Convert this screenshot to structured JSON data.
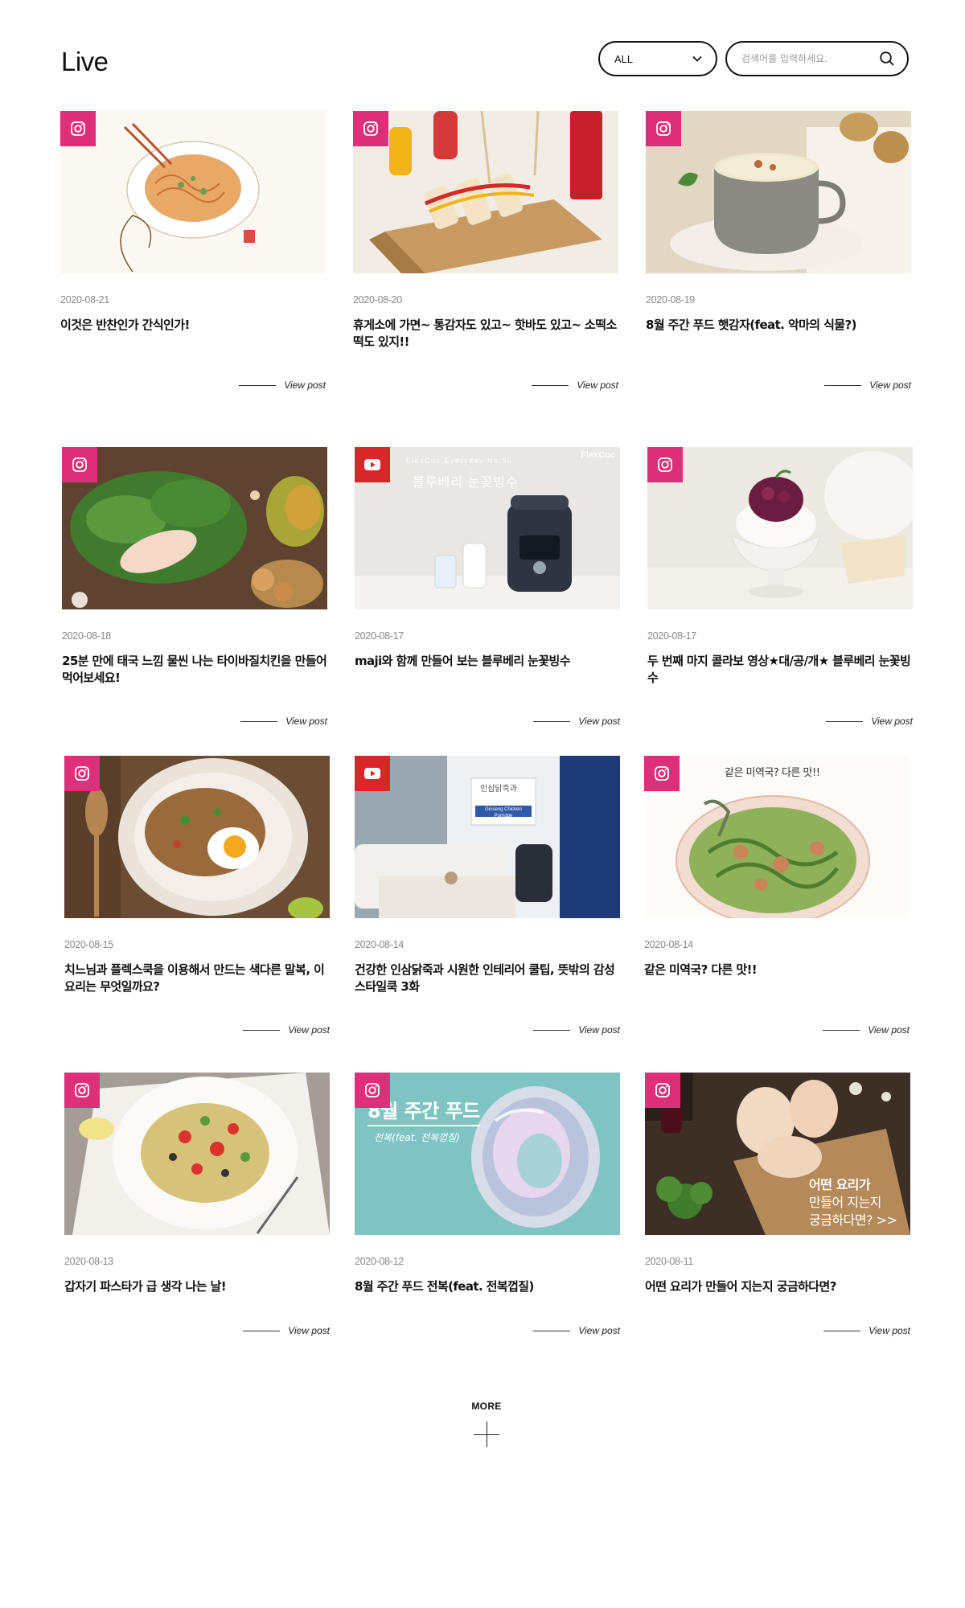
{
  "header": {
    "title": "Live",
    "filter": {
      "value": "ALL"
    },
    "search": {
      "placeholder": "검색어를 입력하세요."
    }
  },
  "posts": [
    {
      "type": "instagram",
      "date": "2020-08-21",
      "title": "이것은 반찬인가 간식인가!",
      "link": "View post"
    },
    {
      "type": "instagram",
      "date": "2020-08-20",
      "title": "휴게소에 가면~ 통감자도 있고~ 핫바도 있고~ 소떡소떡도 있지!!",
      "link": "View post"
    },
    {
      "type": "instagram",
      "date": "2020-08-19",
      "title": "8월 주간 푸드 햇감자(feat. 악마의 식물?)",
      "link": "View post"
    },
    {
      "type": "instagram",
      "date": "2020-08-18",
      "title": "25분 만에 태국 느낌 물씬 나는 타이바질치킨을 만들어 먹어보세요!",
      "link": "View post"
    },
    {
      "type": "youtube",
      "date": "2020-08-17",
      "title": "maji와 함께 만들어 보는 블루베리 눈꽃빙수",
      "link": "View post",
      "overlay": {
        "brand": "FlexCuc",
        "sub": "FlexCuc Everyday No.95",
        "text": "블루베리 눈꽃빙수"
      }
    },
    {
      "type": "instagram",
      "date": "2020-08-17",
      "title": "두 번째 마지 콜라보 영상★대/공/개★ 블루베리 눈꽃빙수",
      "link": "View post"
    },
    {
      "type": "instagram",
      "date": "2020-08-15",
      "title": "치느님과 플렉스쿡을 이용해서 만드는 색다른 말복, 이 요리는 무엇일까요?",
      "link": "View post"
    },
    {
      "type": "youtube",
      "date": "2020-08-14",
      "title": "건강한 인삼닭죽과 시원한 인테리어 쿨팁, 뜻밖의 감성 스타일쿡 3화",
      "link": "View post",
      "overlay": {
        "text": "인삼닭죽과",
        "sub": "Ginseng Chicken Porridge"
      }
    },
    {
      "type": "instagram",
      "date": "2020-08-14",
      "title": "같은 미역국? 다른 맛!!",
      "link": "View post",
      "overlay": {
        "text": "같은 미역국? 다른 맛!!"
      }
    },
    {
      "type": "instagram",
      "date": "2020-08-13",
      "title": "갑자기 파스타가 급 생각 나는 날!",
      "link": "View post"
    },
    {
      "type": "instagram",
      "date": "2020-08-12",
      "title": "8월 주간 푸드 전복(feat. 전복껍질)",
      "link": "View post",
      "overlay": {
        "text": "8월 주간 푸드",
        "sub": "전복(feat. 전복껍질)"
      }
    },
    {
      "type": "instagram",
      "date": "2020-08-11",
      "title": "어떤 요리가 만들어 지는지 궁금하다면?",
      "link": "View post",
      "overlay": {
        "line1": "어떤 요리가",
        "line2": "만들어 지는지",
        "line3": "궁금하다면? >>"
      }
    }
  ],
  "more": {
    "label": "MORE"
  },
  "colors": {
    "instagram": "#dd2f7a",
    "youtube": "#d9262a",
    "text": "#111111",
    "muted": "#888888"
  }
}
